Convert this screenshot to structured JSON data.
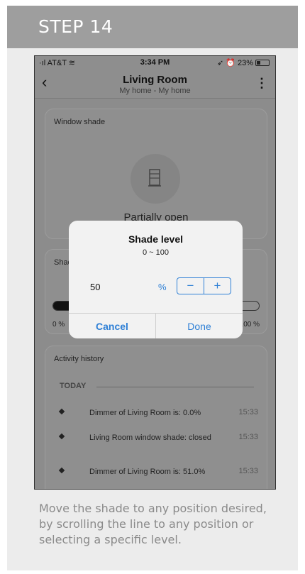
{
  "step": {
    "title": "STEP 14"
  },
  "statusbar": {
    "carrier": "AT&T",
    "time": "3:34 PM",
    "battery": "23%"
  },
  "navbar": {
    "back": "‹",
    "title": "Living Room",
    "subtitle": "My home - My home",
    "more": "⋮"
  },
  "window_shade": {
    "label": "Window shade",
    "state": "Partially open"
  },
  "shade_level_panel": {
    "label": "Shade level",
    "min_label": "0 %",
    "max_label": "100 %",
    "fill_fraction": 0.17
  },
  "activity": {
    "label": "Activity history",
    "section": "TODAY",
    "items": [
      {
        "text": "Dimmer of Living Room is: 0.0%",
        "time": "15:33"
      },
      {
        "text": "Living Room window shade: closed",
        "time": "15:33"
      },
      {
        "text": "Dimmer of Living Room is: 51.0%",
        "time": "15:33"
      }
    ]
  },
  "dialog": {
    "title": "Shade level",
    "range": "0 ~ 100",
    "value": "50",
    "unit": "%",
    "minus": "−",
    "plus": "+",
    "cancel": "Cancel",
    "done": "Done"
  },
  "caption": "Move the shade to any position desired, by scrolling the line to any position or selecting a specific level.",
  "colors": {
    "accent": "#2f80d6",
    "header": "#9e9e9e",
    "card": "#ececec",
    "caption": "#8a8a8a"
  }
}
